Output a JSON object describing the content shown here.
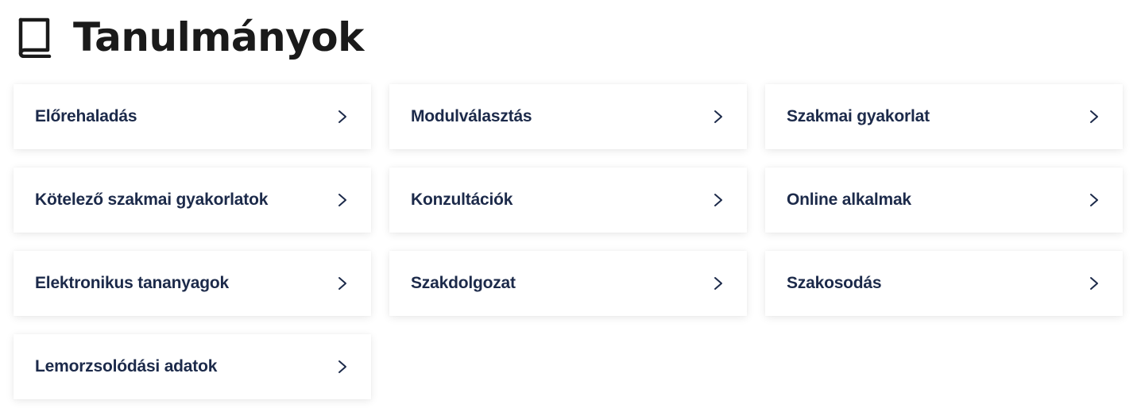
{
  "header": {
    "icon": "book-icon",
    "title": "Tanulmányok"
  },
  "colors": {
    "title": "#1a1a1a",
    "card_text": "#1c2a4a",
    "chevron": "#1c2a4a",
    "card_background": "#ffffff"
  },
  "cards": [
    {
      "label": "Előrehaladás",
      "icon": "chevron-right-icon"
    },
    {
      "label": "Modulválasztás",
      "icon": "chevron-right-icon"
    },
    {
      "label": "Szakmai gyakorlat",
      "icon": "chevron-right-icon"
    },
    {
      "label": "Kötelező szakmai gyakorlatok",
      "icon": "chevron-right-icon"
    },
    {
      "label": "Konzultációk",
      "icon": "chevron-right-icon"
    },
    {
      "label": "Online alkalmak",
      "icon": "chevron-right-icon"
    },
    {
      "label": "Elektronikus tananyagok",
      "icon": "chevron-right-icon"
    },
    {
      "label": "Szakdolgozat",
      "icon": "chevron-right-icon"
    },
    {
      "label": "Szakosodás",
      "icon": "chevron-right-icon"
    },
    {
      "label": "Lemorzsolódási adatok",
      "icon": "chevron-right-icon"
    }
  ]
}
